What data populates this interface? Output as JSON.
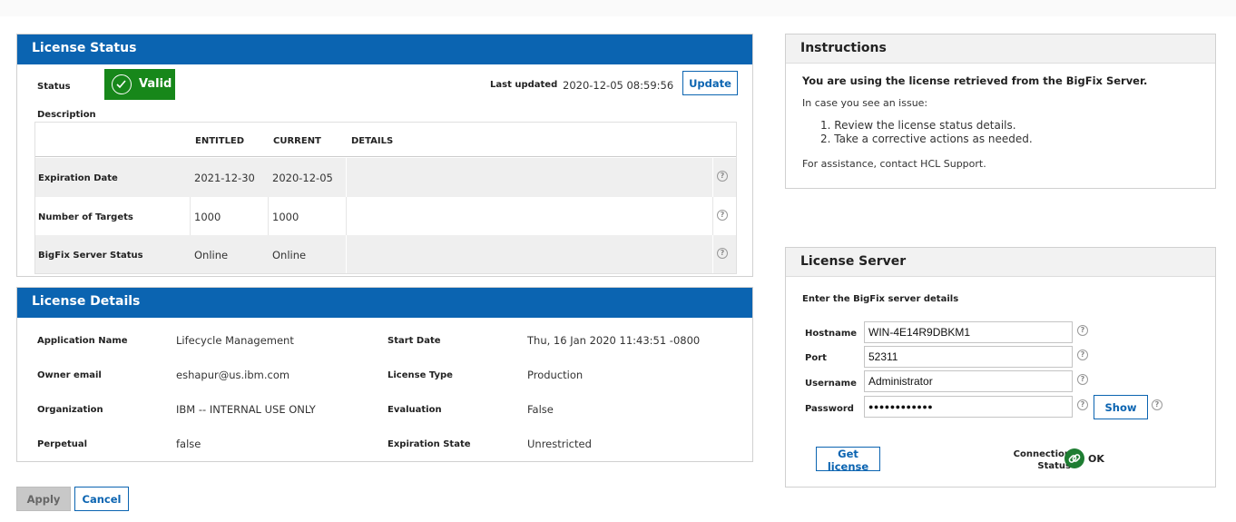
{
  "license_status": {
    "title": "License Status",
    "status_label": "Status",
    "status_value": "Valid",
    "last_updated_label": "Last updated",
    "last_updated_value": "2020-12-05 08:59:56",
    "update_button": "Update",
    "description_label": "Description",
    "table": {
      "headers": [
        "ENTITLED",
        "CURRENT",
        "DETAILS"
      ],
      "rows": [
        {
          "label": "Expiration Date",
          "entitled": "2021-12-30",
          "current": "2020-12-05",
          "details": ""
        },
        {
          "label": "Number of Targets",
          "entitled": "1000",
          "current": "1000",
          "details": ""
        },
        {
          "label": "BigFix Server Status",
          "entitled": "Online",
          "current": "Online",
          "details": ""
        }
      ]
    }
  },
  "license_details": {
    "title": "License Details",
    "fields": [
      {
        "label": "Application Name",
        "value": "Lifecycle Management"
      },
      {
        "label": "Owner email",
        "value": "eshapur@us.ibm.com"
      },
      {
        "label": "Organization",
        "value": "IBM -- INTERNAL USE ONLY"
      },
      {
        "label": "Perpetual",
        "value": "false"
      },
      {
        "label": "Start Date",
        "value": "Thu, 16 Jan 2020 11:43:51 -0800"
      },
      {
        "label": "License Type",
        "value": "Production"
      },
      {
        "label": "Evaluation",
        "value": "False"
      },
      {
        "label": "Expiration State",
        "value": "Unrestricted"
      }
    ]
  },
  "instructions": {
    "title": "Instructions",
    "headline": "You are using the license retrieved from the BigFix Server.",
    "intro": "In case you see an issue:",
    "steps": [
      "1. Review the license status details.",
      "2. Take a corrective actions as needed."
    ],
    "footer": "For assistance, contact HCL Support."
  },
  "license_server": {
    "title": "License Server",
    "subtitle": "Enter the BigFix server details",
    "hostname_label": "Hostname",
    "hostname_value": "WIN-4E14R9DBKM1",
    "port_label": "Port",
    "port_value": "52311",
    "username_label": "Username",
    "username_value": "Administrator",
    "password_label": "Password",
    "password_value": "●●●●●●●●●●●●",
    "show_button": "Show",
    "get_license_button": "Get license",
    "connection_label_1": "Connection",
    "connection_label_2": "Status",
    "connection_value": "OK"
  },
  "footer": {
    "apply_button": "Apply",
    "cancel_button": "Cancel"
  },
  "colors": {
    "header_blue": "#0b64b1",
    "valid_green": "#17871a",
    "ok_green": "#1e7d32"
  },
  "icons": {
    "help": "question-circle-icon",
    "valid": "check-circle-icon",
    "link": "link-icon"
  }
}
